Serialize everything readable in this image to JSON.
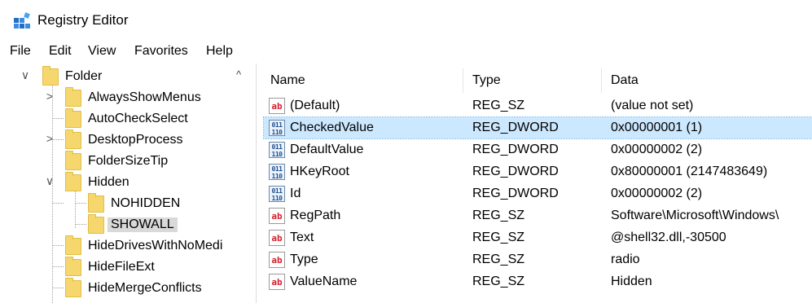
{
  "window": {
    "title": "Registry Editor"
  },
  "menu": [
    "File",
    "Edit",
    "View",
    "Favorites",
    "Help"
  ],
  "tree": [
    {
      "label": "Folder",
      "expander": "∨"
    },
    {
      "label": "AlwaysShowMenus",
      "expander": ">"
    },
    {
      "label": "AutoCheckSelect",
      "expander": ""
    },
    {
      "label": "DesktopProcess",
      "expander": ">"
    },
    {
      "label": "FolderSizeTip",
      "expander": ""
    },
    {
      "label": "Hidden",
      "expander": "∨"
    },
    {
      "label": "NOHIDDEN",
      "expander": ""
    },
    {
      "label": "SHOWALL",
      "expander": "",
      "selected": true
    },
    {
      "label": "HideDrivesWithNoMedi",
      "expander": ""
    },
    {
      "label": "HideFileExt",
      "expander": ""
    },
    {
      "label": "HideMergeConflicts",
      "expander": ""
    }
  ],
  "tree_scroll_up_glyph": "^",
  "columns": {
    "name": "Name",
    "type": "Type",
    "data": "Data"
  },
  "values": [
    {
      "icon": "string-value-icon",
      "glyph": "ab",
      "name": "(Default)",
      "type": "REG_SZ",
      "data": "(value not set)"
    },
    {
      "icon": "binary-value-icon",
      "glyph": "011\n110",
      "name": "CheckedValue",
      "type": "REG_DWORD",
      "data": "0x00000001 (1)",
      "selected": true
    },
    {
      "icon": "binary-value-icon",
      "glyph": "011\n110",
      "name": "DefaultValue",
      "type": "REG_DWORD",
      "data": "0x00000002 (2)"
    },
    {
      "icon": "binary-value-icon",
      "glyph": "011\n110",
      "name": "HKeyRoot",
      "type": "REG_DWORD",
      "data": "0x80000001 (2147483649)"
    },
    {
      "icon": "binary-value-icon",
      "glyph": "011\n110",
      "name": "Id",
      "type": "REG_DWORD",
      "data": "0x00000002 (2)"
    },
    {
      "icon": "string-value-icon",
      "glyph": "ab",
      "name": "RegPath",
      "type": "REG_SZ",
      "data": "Software\\Microsoft\\Windows\\"
    },
    {
      "icon": "string-value-icon",
      "glyph": "ab",
      "name": "Text",
      "type": "REG_SZ",
      "data": "@shell32.dll,-30500"
    },
    {
      "icon": "string-value-icon",
      "glyph": "ab",
      "name": "Type",
      "type": "REG_SZ",
      "data": "radio"
    },
    {
      "icon": "string-value-icon",
      "glyph": "ab",
      "name": "ValueName",
      "type": "REG_SZ",
      "data": "Hidden"
    }
  ]
}
